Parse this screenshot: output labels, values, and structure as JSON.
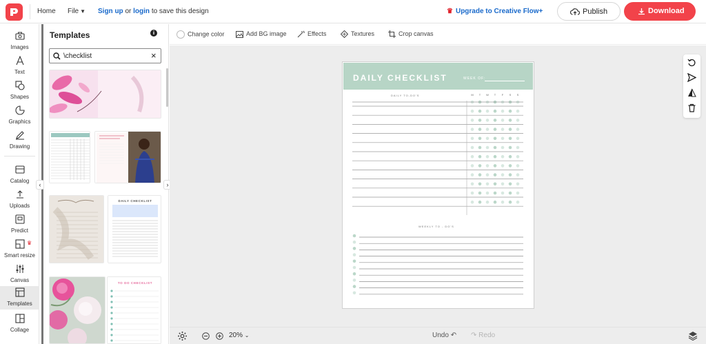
{
  "app": {
    "brand_color": "#f2434a",
    "link_color": "#1a6acb"
  },
  "topbar": {
    "home": "Home",
    "file": "File",
    "sign_up": "Sign up",
    "or": "or",
    "login": "login",
    "save_tail": "to save this design",
    "upgrade": "Upgrade to Creative Flow+",
    "publish": "Publish",
    "download": "Download"
  },
  "rail": {
    "items": [
      {
        "label": "Images",
        "icon": "camera-icon"
      },
      {
        "label": "Text",
        "icon": "text-icon"
      },
      {
        "label": "Shapes",
        "icon": "shapes-icon"
      },
      {
        "label": "Graphics",
        "icon": "graphics-icon"
      },
      {
        "label": "Drawing",
        "icon": "pen-icon"
      },
      {
        "label": "Catalog",
        "icon": "catalog-icon"
      },
      {
        "label": "Uploads",
        "icon": "upload-icon"
      },
      {
        "label": "Predict",
        "icon": "predict-icon"
      },
      {
        "label": "Smart resize",
        "icon": "resize-icon"
      },
      {
        "label": "Canvas",
        "icon": "sliders-icon"
      },
      {
        "label": "Templates",
        "icon": "templates-icon"
      },
      {
        "label": "Collage",
        "icon": "collage-icon"
      }
    ]
  },
  "panel": {
    "title": "Templates",
    "search_value": "\\checklist",
    "thumb_2b_title": "DAILY CHECKLIST",
    "thumb_3b_title": "TO DO CHECKLIST"
  },
  "toolbar": {
    "change_color": "Change color",
    "add_bg_image": "Add BG image",
    "effects": "Effects",
    "textures": "Textures",
    "crop_canvas": "Crop canvas"
  },
  "document": {
    "title": "DAILY CHECKLIST",
    "week_label": "WEEK OF:",
    "daily_heading": "DAILY TO-DO'S",
    "weekly_heading": "WEEKLY TO - DO'S",
    "days": [
      "M",
      "T",
      "W",
      "T",
      "F",
      "S",
      "S"
    ],
    "accent": "#b7d5c6"
  },
  "bottombar": {
    "zoom": "20%",
    "undo": "Undo",
    "redo": "Redo"
  }
}
